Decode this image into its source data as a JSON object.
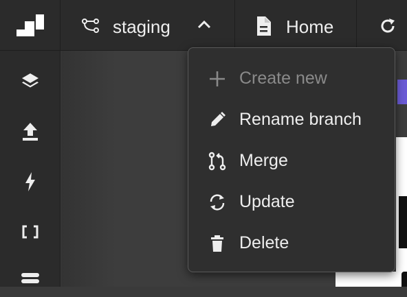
{
  "topbar": {
    "logo_icon": "brand-logo-icon",
    "branch": {
      "name": "staging",
      "icon": "branch-icon",
      "toggle_icon": "chevron-up-icon"
    },
    "page": {
      "label": "Home",
      "icon": "document-icon"
    },
    "refresh_icon": "refresh-icon"
  },
  "sidebar": {
    "items": [
      {
        "name": "layers",
        "icon": "layers-icon"
      },
      {
        "name": "publish",
        "icon": "upload-icon"
      },
      {
        "name": "actions",
        "icon": "lightning-icon"
      },
      {
        "name": "code",
        "icon": "brackets-icon"
      },
      {
        "name": "database",
        "icon": "database-icon"
      }
    ]
  },
  "branch_menu": {
    "items": [
      {
        "label": "Create new",
        "icon": "plus-icon",
        "disabled": true
      },
      {
        "label": "Rename branch",
        "icon": "pencil-icon",
        "disabled": false
      },
      {
        "label": "Merge",
        "icon": "merge-icon",
        "disabled": false
      },
      {
        "label": "Update",
        "icon": "sync-icon",
        "disabled": false
      },
      {
        "label": "Delete",
        "icon": "trash-icon",
        "disabled": false
      }
    ]
  },
  "colors": {
    "background": "#3a3a3a",
    "panel": "#2b2b2b",
    "menu_bg": "#2f2f2f",
    "text": "#eeeeee",
    "disabled_text": "#8a8a8a",
    "accent": "#6b5bd6"
  }
}
